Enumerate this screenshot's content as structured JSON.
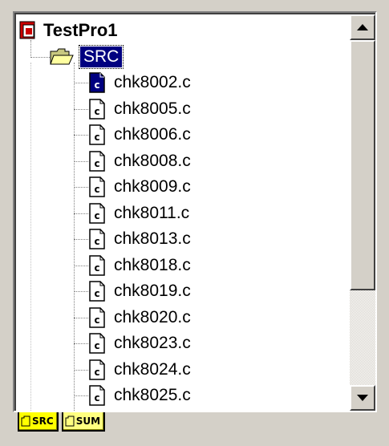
{
  "tree": {
    "root_label": "TestPro1",
    "folder_label": "SRC",
    "files": [
      "chk8002.c",
      "chk8005.c",
      "chk8006.c",
      "chk8008.c",
      "chk8009.c",
      "chk8011.c",
      "chk8013.c",
      "chk8018.c",
      "chk8019.c",
      "chk8020.c",
      "chk8023.c",
      "chk8024.c",
      "chk8025.c"
    ],
    "selected_file_index": 0
  },
  "tabs": [
    {
      "label": "SRC",
      "active": true
    },
    {
      "label": "SUM",
      "active": false
    }
  ],
  "icons": {
    "project": "project-icon",
    "folder": "open-folder-icon",
    "file": "c-file-icon"
  },
  "colors": {
    "selection": "#000080",
    "tab": "#ffff00",
    "project_icon": "#cc0000"
  }
}
